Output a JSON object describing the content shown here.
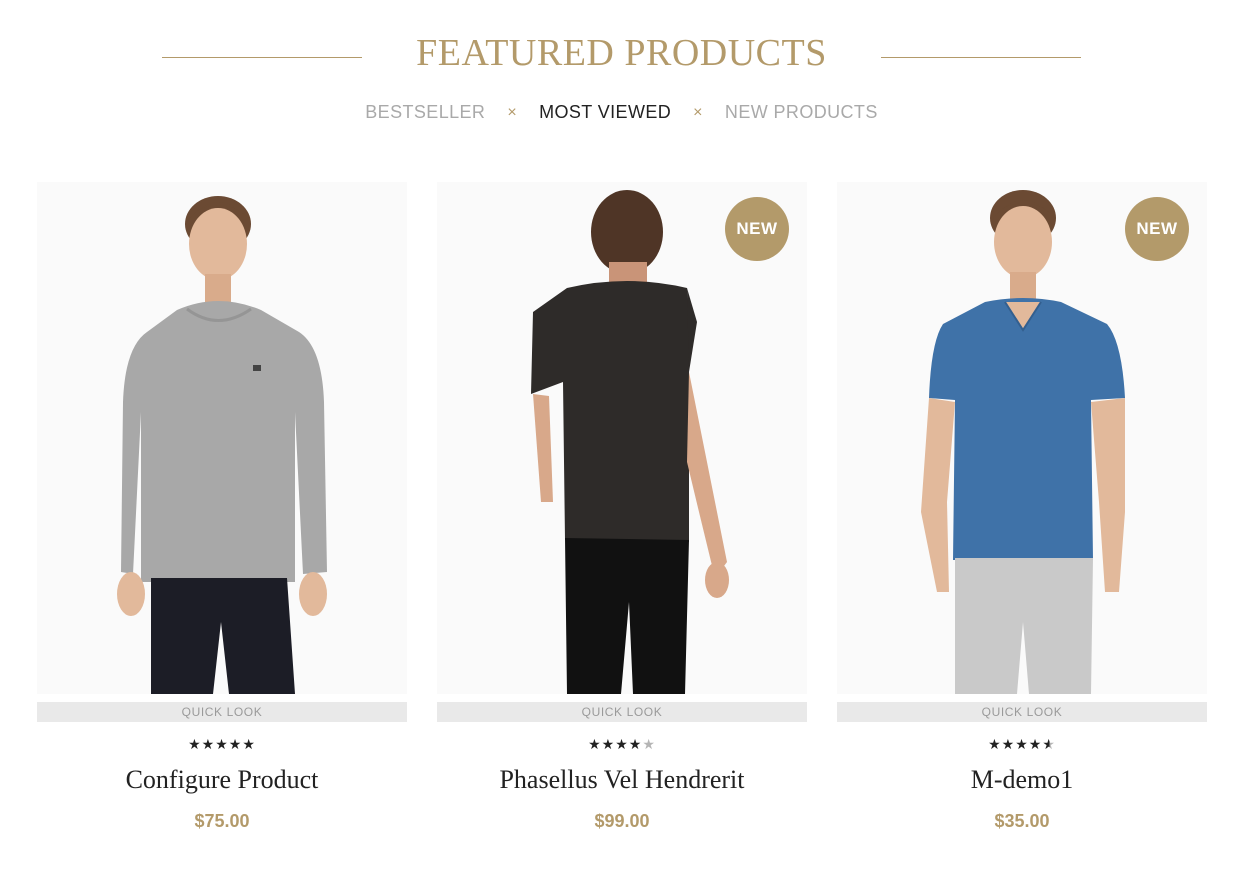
{
  "section": {
    "title": "FEATURED PRODUCTS",
    "separator": "×",
    "tabs": [
      {
        "label": "BESTSELLER",
        "active": false
      },
      {
        "label": "MOST VIEWED",
        "active": true
      },
      {
        "label": "NEW PRODUCTS",
        "active": false
      }
    ]
  },
  "colors": {
    "accent": "#b39a6a",
    "text": "#222222",
    "muted": "#a9a9a9"
  },
  "products": [
    {
      "name": "Configure Product",
      "price": "$75.00",
      "rating": 5,
      "rating_max": 5,
      "quick_look": "QUICK LOOK",
      "badge": "",
      "image": "man-grey-long-sleeve-front"
    },
    {
      "name": "Phasellus Vel Hendrerit",
      "price": "$99.00",
      "rating": 4,
      "rating_max": 5,
      "quick_look": "QUICK LOOK",
      "badge": "NEW",
      "image": "man-black-tshirt-back"
    },
    {
      "name": "M-demo1",
      "price": "$35.00",
      "rating": 4.5,
      "rating_max": 5,
      "quick_look": "QUICK LOOK",
      "badge": "NEW",
      "image": "man-blue-vneck-front"
    }
  ]
}
